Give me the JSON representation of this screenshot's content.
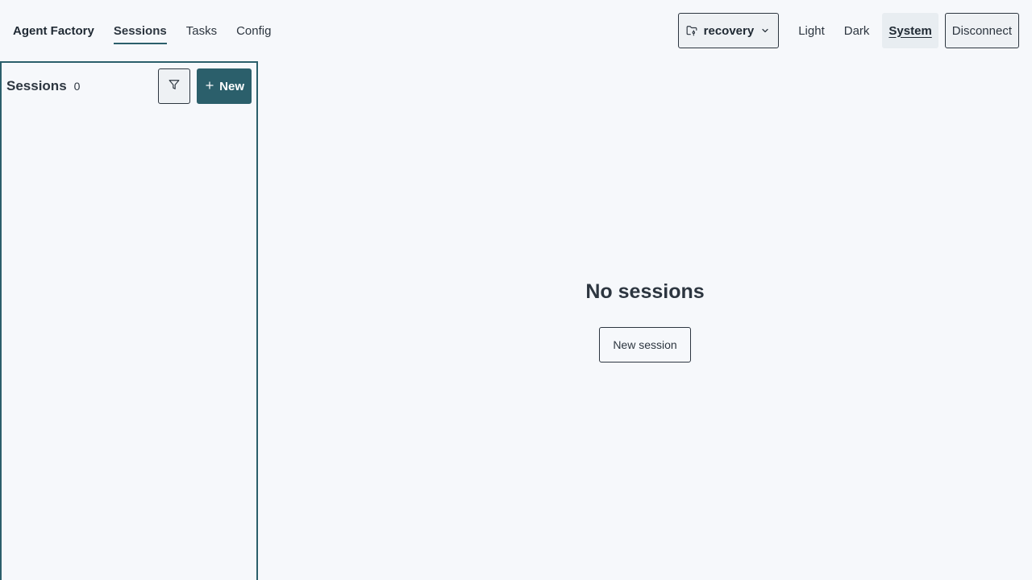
{
  "nav": {
    "brand": "Agent Factory",
    "links": [
      "Sessions",
      "Tasks",
      "Config"
    ],
    "active": "Sessions"
  },
  "repo": {
    "name": "recovery",
    "icon": "folder-git-icon"
  },
  "theme": {
    "options": [
      "Light",
      "Dark",
      "System"
    ],
    "selected": "System"
  },
  "disconnect_label": "Disconnect",
  "sidebar": {
    "title": "Sessions",
    "count": "0",
    "filter_icon": "filter-icon",
    "new_label": "New"
  },
  "main": {
    "empty_title": "No sessions",
    "new_session_label": "New session"
  },
  "colors": {
    "accent": "#2b5f6b",
    "background": "#f6f8fb"
  }
}
